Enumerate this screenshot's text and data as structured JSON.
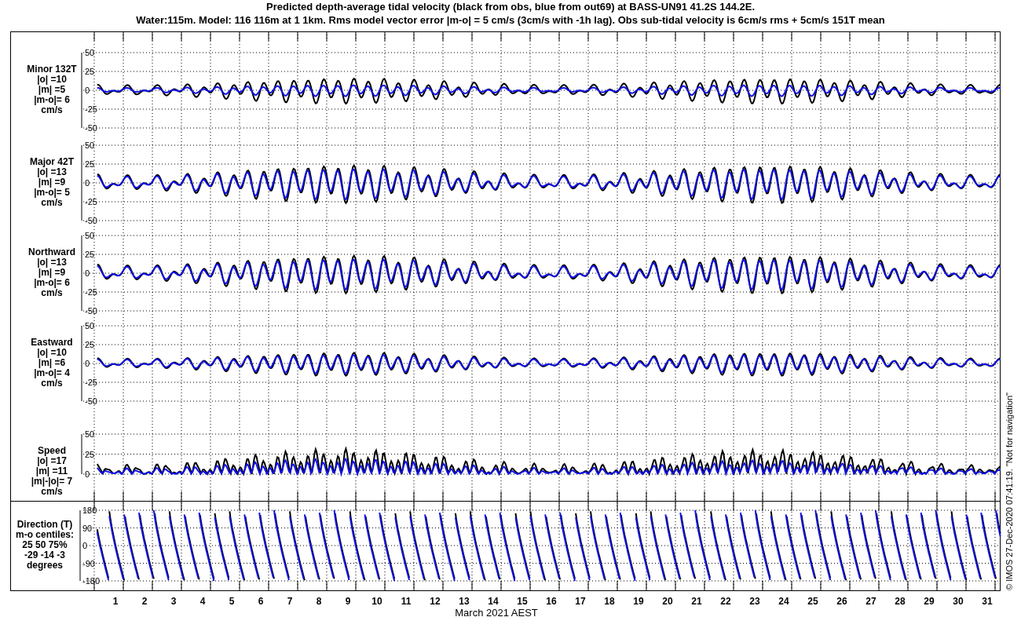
{
  "title": {
    "line_1": "Predicted depth-average tidal velocity (black from obs, blue from out69) at BASS-UN91 41.2S 144.2E.",
    "line_2": "Water:115m. Model: 116 116m at 1 1km. Rms model vector error |m-o| = 5 cm/s (3cm/s with -1h lag). Obs sub-tidal velocity is 6cm/s rms + 5cm/s 151T mean"
  },
  "panels": [
    {
      "kind": "minor",
      "label_lines": [
        "Minor 132T",
        "|o| =10",
        "|m| =5",
        "|m-o|= 6",
        "cm/s"
      ],
      "yticks": [
        "50",
        "25",
        "0",
        "-25",
        "-50"
      ]
    },
    {
      "kind": "major",
      "label_lines": [
        "Major 42T",
        "|o| =13",
        "|m| =9",
        "|m-o|= 5",
        "cm/s"
      ],
      "yticks": [
        "50",
        "25",
        "0",
        "-25",
        "-50"
      ]
    },
    {
      "kind": "north",
      "label_lines": [
        "Northward",
        "|o| =13",
        "|m| =9",
        "|m-o|= 6",
        "cm/s"
      ],
      "yticks": [
        "50",
        "25",
        "0",
        "-25",
        "-50"
      ]
    },
    {
      "kind": "east",
      "label_lines": [
        "Eastward",
        "|o| =10",
        "|m| =6",
        "|m-o|= 4",
        "cm/s"
      ],
      "yticks": [
        "50",
        "25",
        "0",
        "-25",
        "-50"
      ]
    },
    {
      "kind": "speed",
      "label_lines": [
        "Speed",
        "|o| =17",
        "|m| =11",
        "|m|-|o|= 7",
        "cm/s"
      ],
      "yticks": [
        "50",
        "25",
        "0"
      ]
    }
  ],
  "direction_panel": {
    "label_lines": [
      "Direction (T)",
      "m-o centiles:",
      "25  50  75%",
      "-29 -14  -3",
      "degrees"
    ],
    "yticks": [
      "180",
      "90",
      "0",
      "-90",
      "-180"
    ]
  },
  "x_axis": {
    "day_labels": [
      "1",
      "2",
      "3",
      "4",
      "5",
      "6",
      "7",
      "8",
      "9",
      "10",
      "11",
      "12",
      "13",
      "14",
      "15",
      "16",
      "17",
      "18",
      "19",
      "20",
      "21",
      "22",
      "23",
      "24",
      "25",
      "26",
      "27",
      "28",
      "29",
      "30",
      "31"
    ],
    "title": "March 2021 AEST"
  },
  "credit": "© IMOS 27-Dec-2020 07:41:19. \"Not for navigation\""
}
